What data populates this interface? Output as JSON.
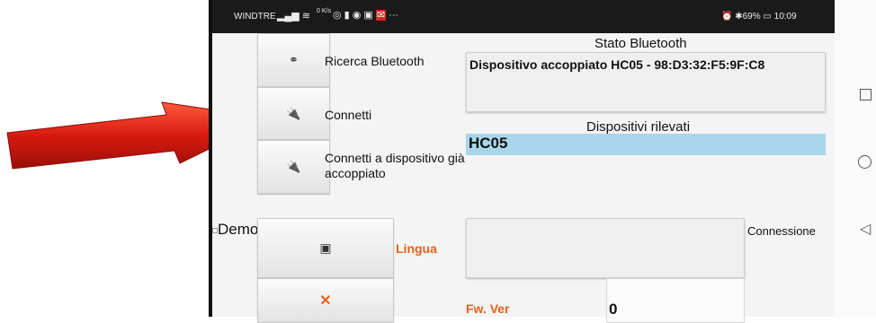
{
  "status_bar": {
    "carrier": "WINDTRE",
    "net_speed": "0 K/s",
    "right_info": "⏰ ✱69% ▭ 10:09"
  },
  "buttons": {
    "search_bluetooth": "Ricerca Bluetooth",
    "connect": "Connetti",
    "connect_paired": "Connetti a dispositivo già accoppiato"
  },
  "bluetooth_status": {
    "title": "Stato Bluetooth",
    "value": "Dispositivo accoppiato HC05 - 98:D3:32:F5:9F:C8"
  },
  "detected_devices": {
    "title": "Dispositivi rilevati",
    "items": [
      "HC05"
    ]
  },
  "demo": {
    "label": "Demo"
  },
  "connection": {
    "label": "Connessione"
  },
  "language": {
    "label": "Lingua",
    "value": ""
  },
  "firmware": {
    "label": "Fw. Ver",
    "value": "0"
  },
  "colors": {
    "accent_orange": "#e8621a",
    "selection_blue": "#a9d6ea",
    "arrow_red": "#d81a10"
  }
}
